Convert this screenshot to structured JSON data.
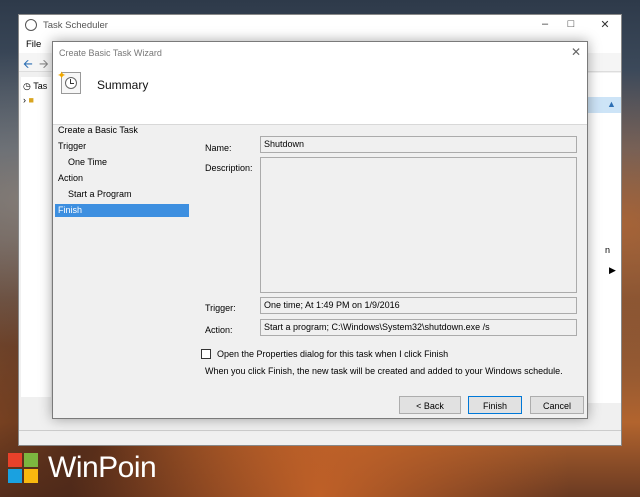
{
  "main_window": {
    "title": "Task Scheduler",
    "menu_file": "File",
    "controls": [
      "–",
      "□",
      "✕"
    ],
    "tree_item": "Tas",
    "right_fragment": "n"
  },
  "wizard": {
    "title": "Create Basic Task Wizard",
    "heading": "Summary",
    "steps": [
      {
        "label": "Create a Basic Task"
      },
      {
        "label": "Trigger"
      },
      {
        "label": "One Time"
      },
      {
        "label": "Action"
      },
      {
        "label": "Start a Program"
      },
      {
        "label": "Finish"
      }
    ],
    "fields": {
      "name_label": "Name:",
      "name_value": "Shutdown",
      "description_label": "Description:",
      "description_value": "",
      "trigger_label": "Trigger:",
      "trigger_value": "One time; At 1:49 PM on 1/9/2016",
      "action_label": "Action:",
      "action_value": "Start a program; C:\\Windows\\System32\\shutdown.exe /s"
    },
    "open_properties_label": "Open the Properties dialog for this task when I click Finish",
    "open_properties_checked": false,
    "info_text": "When you click Finish, the new task will be created and added to your Windows schedule.",
    "buttons": {
      "back": "< Back",
      "finish": "Finish",
      "cancel": "Cancel"
    }
  },
  "watermark": {
    "text": "WinPoin",
    "colors": [
      "#e8412a",
      "#7cb73f",
      "#1aa1e0",
      "#f9b80f"
    ]
  }
}
